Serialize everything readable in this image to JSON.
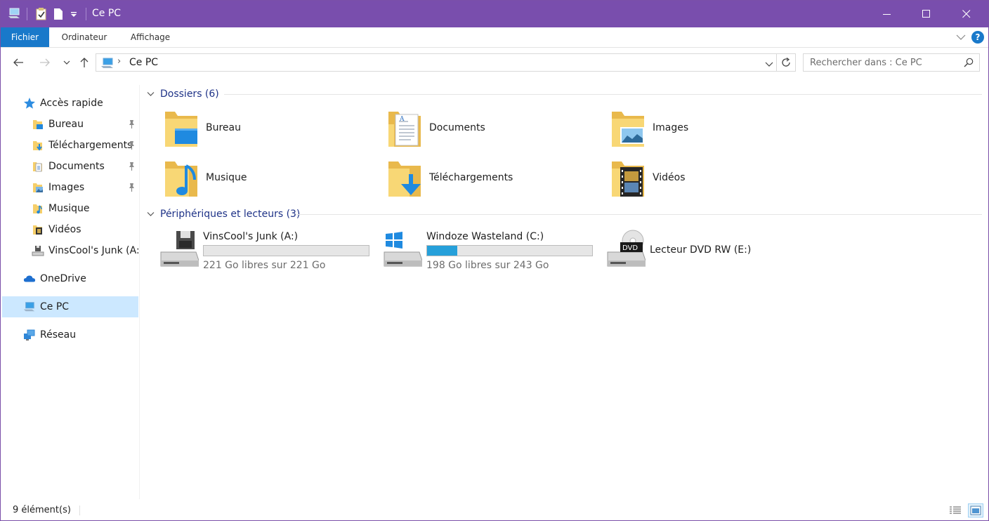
{
  "window": {
    "title": "Ce PC",
    "accent": "#794ead"
  },
  "titlebar": {
    "quick_access_icons": [
      "computer-icon",
      "properties-icon",
      "new-folder-icon",
      "customize-dropdown-icon"
    ],
    "buttons": [
      "minimize",
      "maximize",
      "close"
    ]
  },
  "ribbon": {
    "tabs": [
      {
        "label": "Fichier",
        "active": true
      },
      {
        "label": "Ordinateur"
      },
      {
        "label": "Affichage"
      }
    ],
    "help": "?"
  },
  "address": {
    "crumbs": [
      "Ce PC"
    ],
    "search_placeholder": "Rechercher dans : Ce PC"
  },
  "sidebar": {
    "quick_access": {
      "label": "Accès rapide",
      "icon": "star-icon"
    },
    "pinned": [
      {
        "label": "Bureau",
        "icon": "desktop-folder-icon",
        "pinned": true
      },
      {
        "label": "Téléchargements",
        "icon": "downloads-folder-icon",
        "pinned": true
      },
      {
        "label": "Documents",
        "icon": "documents-folder-icon",
        "pinned": true
      },
      {
        "label": "Images",
        "icon": "pictures-folder-icon",
        "pinned": true
      },
      {
        "label": "Musique",
        "icon": "music-folder-icon",
        "pinned": false
      },
      {
        "label": "Vidéos",
        "icon": "videos-folder-icon",
        "pinned": false
      },
      {
        "label": "VinsCool's Junk (A:)",
        "icon": "floppy-drive-icon",
        "pinned": false
      }
    ],
    "onedrive": {
      "label": "OneDrive",
      "icon": "cloud-icon"
    },
    "this_pc": {
      "label": "Ce PC",
      "icon": "computer-icon",
      "selected": true
    },
    "network": {
      "label": "Réseau",
      "icon": "network-icon"
    }
  },
  "content": {
    "folders_header": "Dossiers (6)",
    "folders": [
      {
        "name": "Bureau",
        "icon": "desktop-folder-icon"
      },
      {
        "name": "Documents",
        "icon": "documents-folder-icon"
      },
      {
        "name": "Images",
        "icon": "pictures-folder-icon"
      },
      {
        "name": "Musique",
        "icon": "music-folder-icon"
      },
      {
        "name": "Téléchargements",
        "icon": "downloads-folder-icon"
      },
      {
        "name": "Vidéos",
        "icon": "videos-folder-icon"
      }
    ],
    "devices_header": "Périphériques et lecteurs (3)",
    "drives": [
      {
        "name": "VinsCool's Junk (A:)",
        "icon": "floppy-drive-icon",
        "free": "221 Go libres sur 221 Go",
        "used_fraction": 0.0
      },
      {
        "name": "Windoze Wasteland (C:)",
        "icon": "windows-drive-icon",
        "free": "198 Go libres sur 243 Go",
        "used_fraction": 0.185
      },
      {
        "name": "Lecteur DVD RW (E:)",
        "icon": "dvd-drive-icon"
      }
    ]
  },
  "status": {
    "count": "9 élément(s)",
    "views": [
      "details-view",
      "large-icons-view"
    ]
  }
}
